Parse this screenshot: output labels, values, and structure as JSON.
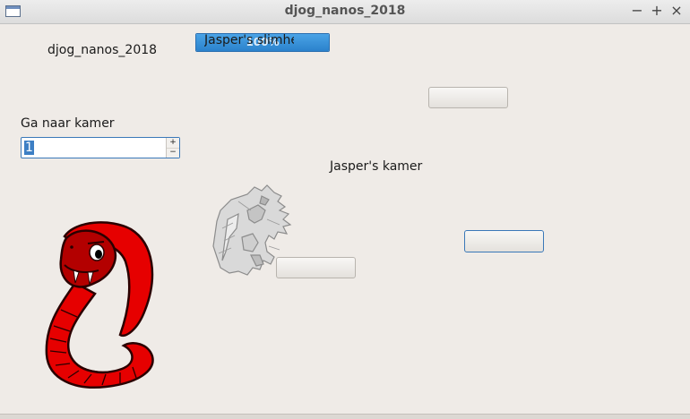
{
  "window": {
    "title": "djog_nanos_2018",
    "minimize_glyph": "−",
    "maximize_glyph": "+",
    "close_glyph": "×"
  },
  "main": {
    "app_label": "djog_nanos_2018",
    "intelligence": {
      "label": "Jasper's slimheid",
      "percent_text": "100%",
      "value": 1.0
    },
    "goto_room_label": "Ga naar kamer",
    "room_spinbox": {
      "value": "1",
      "up_glyph": "+",
      "down_glyph": "−"
    },
    "room_title": "Jasper's kamer",
    "images": {
      "dragon": "dragon-image",
      "snake": "snake-image"
    }
  },
  "colors": {
    "accent": "#2b82cc",
    "snake_red": "#e60000",
    "snake_dark": "#8a0000"
  }
}
